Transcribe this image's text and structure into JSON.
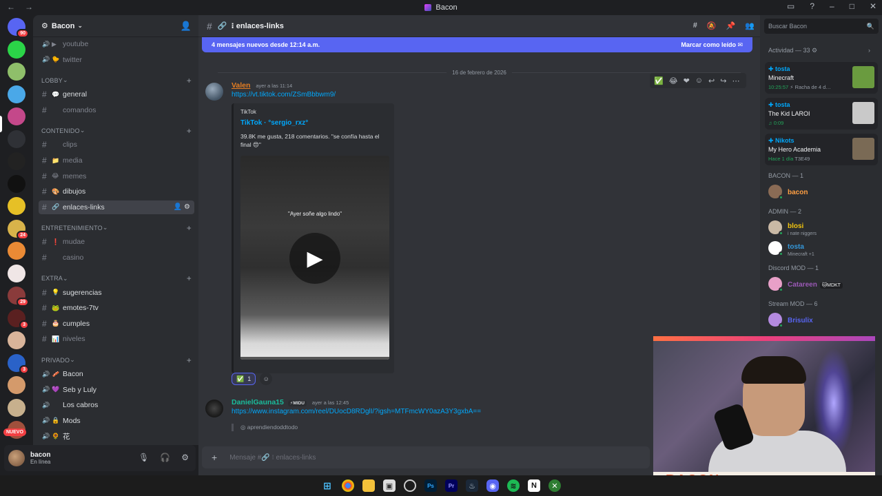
{
  "window": {
    "title": "Bacon"
  },
  "rail": {
    "servers": [
      {
        "name": "discord-home",
        "badge": "90",
        "color": "#5865f2"
      },
      {
        "name": "green-server",
        "badge": "",
        "color": "#2bd448"
      },
      {
        "name": "server-3",
        "badge": "",
        "color": "#8fbf6a"
      },
      {
        "name": "server-4",
        "badge": "",
        "color": "#4aa8e8"
      },
      {
        "name": "bacon-server",
        "badge": "",
        "color": "#c4488a"
      },
      {
        "name": "server-6",
        "badge": "",
        "color": "#2f3136"
      },
      {
        "name": "server-7",
        "badge": "",
        "color": "#222"
      },
      {
        "name": "server-8",
        "badge": "",
        "color": "#111"
      },
      {
        "name": "server-9",
        "badge": "",
        "color": "#e6c026"
      },
      {
        "name": "server-10",
        "badge": "24",
        "color": "#d8b34a"
      },
      {
        "name": "server-11",
        "badge": "",
        "color": "#ea8a35"
      },
      {
        "name": "server-12",
        "badge": "",
        "color": "#f0e6e6"
      },
      {
        "name": "server-13",
        "badge": "29",
        "color": "#8a3b3b"
      },
      {
        "name": "server-14",
        "badge": "3",
        "color": "#5a2020"
      },
      {
        "name": "server-15",
        "badge": "",
        "color": "#d9b49a"
      },
      {
        "name": "server-16",
        "badge": "3",
        "color": "#2a62c8"
      },
      {
        "name": "server-17",
        "badge": "",
        "color": "#d49a6b"
      },
      {
        "name": "server-18",
        "badge": "",
        "color": "#c7b08d"
      },
      {
        "name": "server-19",
        "badge": "",
        "color": "#a0503c"
      }
    ],
    "nuevo": "NUEVO"
  },
  "sidebar": {
    "server_name": "Bacon",
    "channels_top": [
      {
        "label": "youtube",
        "emoji": "▶"
      },
      {
        "label": "twitter",
        "emoji": "🐤"
      }
    ],
    "categories": [
      {
        "label": "LOBBY",
        "channels": [
          {
            "label": "general",
            "emoji": "💬",
            "unread": true
          },
          {
            "label": "comandos",
            "emoji": "",
            "unread": false
          }
        ]
      },
      {
        "label": "CONTENIDO",
        "channels": [
          {
            "label": "clips",
            "emoji": "",
            "unread": false
          },
          {
            "label": "media",
            "emoji": "📁",
            "unread": false
          },
          {
            "label": "memes",
            "emoji": "😂",
            "unread": false
          },
          {
            "label": "dibujos",
            "emoji": "🎨",
            "unread": true
          },
          {
            "label": "enlaces-links",
            "emoji": "🔗",
            "unread": true,
            "active": true
          }
        ]
      },
      {
        "label": "ENTRETENIMIENTO",
        "channels": [
          {
            "label": "mudae",
            "emoji": "❗",
            "unread": false
          },
          {
            "label": "casino",
            "emoji": "",
            "unread": false
          }
        ]
      },
      {
        "label": "EXTRA",
        "channels": [
          {
            "label": "sugerencias",
            "emoji": "💡",
            "unread": true
          },
          {
            "label": "emotes-7tv",
            "emoji": "🐸",
            "unread": true
          },
          {
            "label": "cumples",
            "emoji": "🎂",
            "unread": true
          },
          {
            "label": "niveles",
            "emoji": "📊",
            "unread": false
          }
        ]
      },
      {
        "label": "PRIVADO",
        "channels": [
          {
            "label": "Bacon",
            "emoji": "🥓",
            "unread": true
          },
          {
            "label": "Seb y Luly",
            "emoji": "💜",
            "unread": true
          },
          {
            "label": "Los cabros",
            "emoji": "",
            "unread": true
          },
          {
            "label": "Mods",
            "emoji": "🔒",
            "unread": true
          },
          {
            "label": "花",
            "emoji": "🌻",
            "unread": true
          }
        ]
      }
    ]
  },
  "user": {
    "name": "bacon",
    "status": "En línea"
  },
  "channel": {
    "name": "enlaces-links"
  },
  "banner": {
    "text": "4 mensajes nuevos desde 12:14 a.m.",
    "action": "Marcar como leído"
  },
  "date_divider": "16 de febrero de 2026",
  "messages": [
    {
      "author": "Valen",
      "author_color": "#e67e22",
      "time": "ayer a las 11:14",
      "link": "https://vt.tiktok.com/ZSmBbbwm9/",
      "embed": {
        "provider": "TikTok",
        "title": "TikTok · °sergio_rxz°",
        "description": "39.8K me gusta, 218 comentarios. \"se confía hasta el final 😍\"",
        "video_caption": "\"Ayer soñe algo lindo\""
      },
      "reactions": [
        {
          "emoji": "✅",
          "count": "1"
        }
      ]
    },
    {
      "author": "DanielGauna15",
      "author_color": "#1abc9c",
      "tag": "⚡MIDU",
      "time": "ayer a las 12:45",
      "link": "https://www.instagram.com/reel/DUocD8RDglI/?igsh=MTFmcWY0azA3Y3gxbA==",
      "quoted": "aprendiendoddtodo"
    }
  ],
  "composer": {
    "placeholder": "Mensaje #🔗 ⁝ enlaces-links"
  },
  "right": {
    "search_placeholder": "Buscar Bacon",
    "activity_header": "Actividad — 33",
    "activities": [
      {
        "name": "tosta",
        "title": "Minecraft",
        "meta": "10:25:57",
        "sub": "⚡ Racha de 4 d…",
        "thumb_color": "#6a9b3f"
      },
      {
        "name": "tosta",
        "title": "The Kid LAROI",
        "meta": "♫ 0:09",
        "sub": "",
        "thumb_color": "#c9c9c9"
      },
      {
        "name": "Nikots",
        "title": "My Hero Academia",
        "meta": "Hace 1 día",
        "sub": "T3E49",
        "thumb_color": "#7a6a55"
      }
    ],
    "groups": [
      {
        "label": "BACON — 1",
        "members": [
          {
            "name": "bacon",
            "color": "#ff9f43",
            "sub": "",
            "tag": ""
          }
        ]
      },
      {
        "label": "ADMIN — 2",
        "members": [
          {
            "name": "blosi",
            "color": "#f1c40f",
            "sub": "i nate niggers",
            "tag": ""
          },
          {
            "name": "tosta",
            "color": "#3498db",
            "sub": "Minecraft +1",
            "tag": ""
          }
        ]
      },
      {
        "label": "Discord MOD — 1",
        "members": [
          {
            "name": "Catareen",
            "color": "#9b59b6",
            "sub": "",
            "tag": "🐱MDKT"
          }
        ]
      },
      {
        "label": "Stream MOD — 6",
        "members": [
          {
            "name": "Brisulix",
            "color": "#5865f2",
            "sub": "",
            "tag": ""
          }
        ]
      }
    ]
  },
  "webcam": {
    "label": "BACON"
  }
}
